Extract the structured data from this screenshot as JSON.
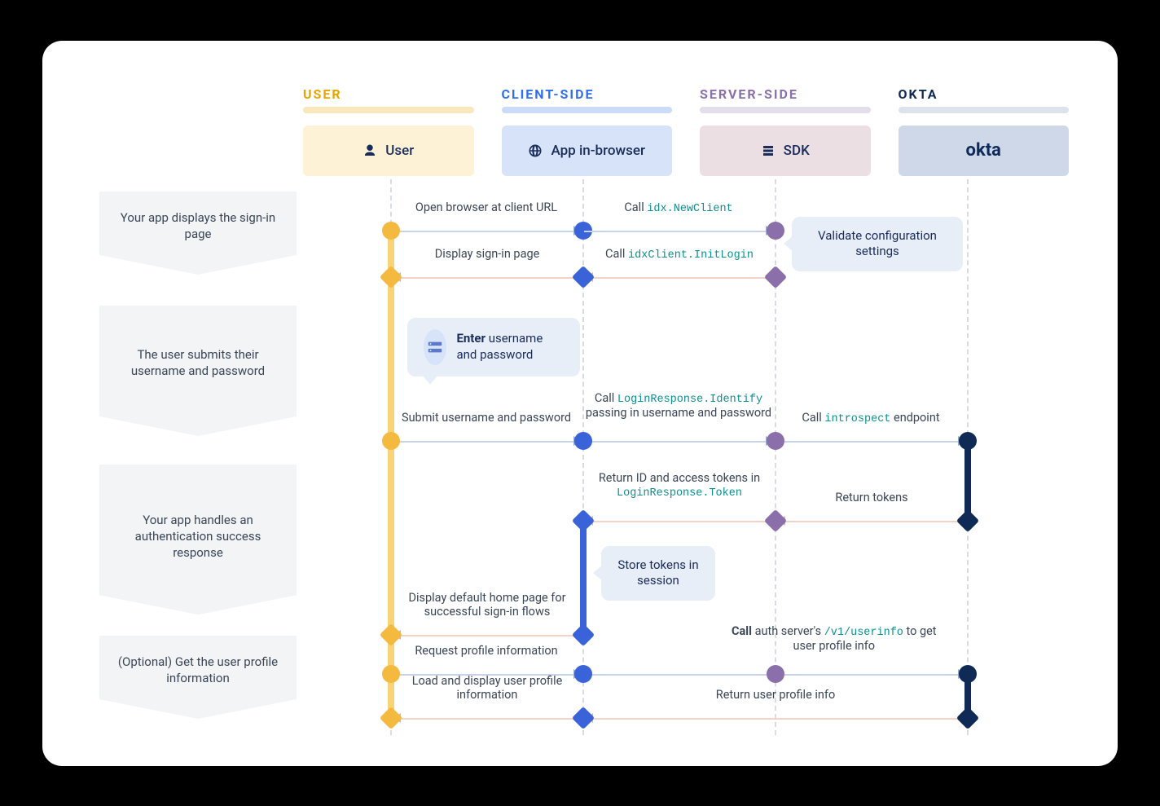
{
  "lanes": {
    "user": {
      "title": "USER",
      "actor": "User"
    },
    "client": {
      "title": "CLIENT-SIDE",
      "actor": "App in-browser"
    },
    "server": {
      "title": "SERVER-SIDE",
      "actor": "SDK"
    },
    "okta": {
      "title": "OKTA",
      "actor": "okta"
    }
  },
  "steps": {
    "s1": "Your app displays the sign-in page",
    "s2": "The user submits their username and password",
    "s3": "Your app handles an authentication success response",
    "s4": "(Optional) Get the user profile information"
  },
  "msgs": {
    "m1": "Open browser at client URL",
    "m2_pre": "Call ",
    "m2_code": "idx.NewClient",
    "m3_pre": "Call ",
    "m3_code": "idxClient.InitLogin",
    "m4": "Display sign-in page",
    "m5": "Submit username and password",
    "m6_pre": "Call ",
    "m6_code": "LoginResponse.Identify",
    "m6_post": " passing in username and password",
    "m7_pre": "Call ",
    "m7_code": "introspect",
    "m7_post": " endpoint",
    "m8": "Return tokens",
    "m9_pre": "Return ID and access tokens in ",
    "m9_code": "LoginResponse.Token",
    "m10": "Display default home page for successful sign-in flows",
    "m11": "Request profile information",
    "m12_boldpre": "Call",
    "m12_mid": " auth server's ",
    "m12_code": "/v1/userinfo",
    "m12_post": " to get user profile info",
    "m13": "Return user profile info",
    "m14": "Load and display user profile information"
  },
  "notes": {
    "n1": "Validate configuration settings",
    "n2_bold": "Enter",
    "n2_rest": " username and password",
    "n3": "Store tokens in session"
  }
}
